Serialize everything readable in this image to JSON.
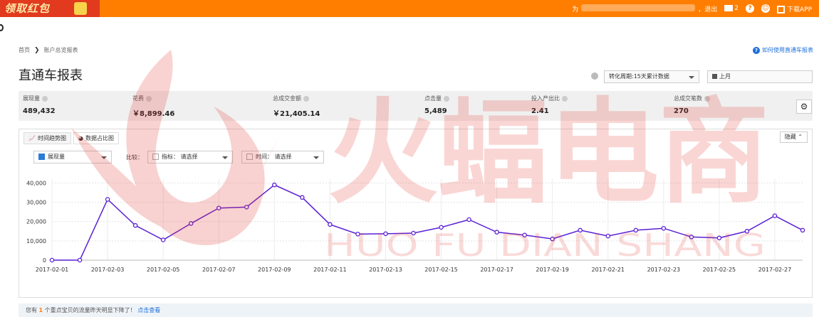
{
  "topbar": {
    "promo_text": "领取红包",
    "user_prefix": "为",
    "logout": "，退出",
    "mail_count": "2",
    "help_symbol": "?",
    "download_app": "下载APP"
  },
  "breadcrumb": {
    "home": "首页",
    "separator": "❯",
    "current": "账户总览报表"
  },
  "help_link": "如何使用直通车报表",
  "page_title": "直通车报表",
  "conversion_period": "转化周期:15天累计数据",
  "date_range": "上月",
  "metrics": [
    {
      "label": "展现量",
      "value": "489,432"
    },
    {
      "label": "花费",
      "value": "￥8,899.46"
    },
    {
      "label": "总成交金额",
      "value": "￥21,405.14"
    },
    {
      "label": "点击量",
      "value": "5,489"
    },
    {
      "label": "投入产出比",
      "value": "2.41"
    },
    {
      "label": "总成交笔数",
      "value": "270"
    }
  ],
  "chart_tabs": {
    "trend": "时间趋势图",
    "share": "数据占比图",
    "hide": "隐藏"
  },
  "filters": {
    "primary_metric": "展现量",
    "compare_label": "比较：",
    "indicator": "指标： 请选择",
    "time": "时间： 请选择"
  },
  "notice": {
    "prefix": "您有",
    "count": "1",
    "middle": "个重点宝贝的流量昨天明显下降了！",
    "link": "点击查看"
  },
  "watermark": {
    "main": "火蝠电商",
    "sub": "HUO FU DIAN SHANG"
  },
  "colors": {
    "orange": "#ff7e00",
    "line": "#5a1fd6",
    "link": "#1e6fd9"
  },
  "chart_data": {
    "type": "line",
    "x": [
      "2017-02-01",
      "2017-02-02",
      "2017-02-03",
      "2017-02-04",
      "2017-02-05",
      "2017-02-06",
      "2017-02-07",
      "2017-02-08",
      "2017-02-09",
      "2017-02-10",
      "2017-02-11",
      "2017-02-12",
      "2017-02-13",
      "2017-02-14",
      "2017-02-15",
      "2017-02-16",
      "2017-02-17",
      "2017-02-18",
      "2017-02-19",
      "2017-02-20",
      "2017-02-21",
      "2017-02-22",
      "2017-02-23",
      "2017-02-24",
      "2017-02-25",
      "2017-02-26",
      "2017-02-27",
      "2017-02-28"
    ],
    "xtick_labels": [
      "2017-02-01",
      "2017-02-03",
      "2017-02-05",
      "2017-02-07",
      "2017-02-09",
      "2017-02-11",
      "2017-02-13",
      "2017-02-15",
      "2017-02-17",
      "2017-02-19",
      "2017-02-21",
      "2017-02-23",
      "2017-02-25",
      "2017-02-27"
    ],
    "series": [
      {
        "name": "展现量",
        "values": [
          0,
          0,
          31500,
          18000,
          10500,
          19000,
          27000,
          27500,
          39000,
          32500,
          18500,
          13500,
          13700,
          14000,
          17000,
          21000,
          14500,
          13000,
          11000,
          15500,
          12500,
          15500,
          16500,
          12000,
          11500,
          15000,
          23000,
          15500
        ]
      }
    ],
    "yticks": [
      0,
      10000,
      20000,
      30000,
      40000
    ],
    "ytick_labels": [
      "0",
      "10,000",
      "20,000",
      "30,000",
      "40,000"
    ],
    "ylim": [
      0,
      42000
    ],
    "grid": true
  }
}
